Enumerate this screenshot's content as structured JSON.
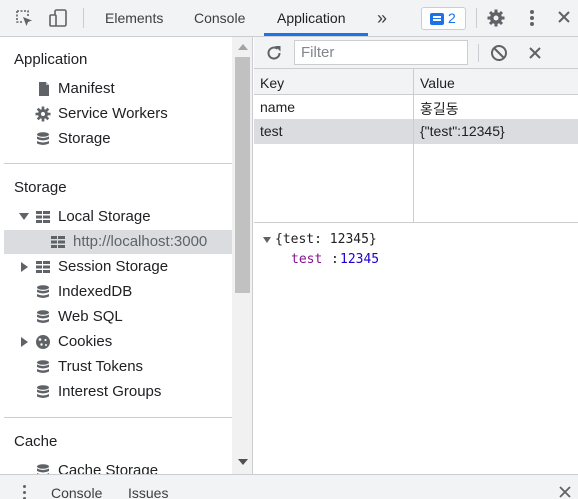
{
  "toolbar": {
    "tabs": [
      {
        "label": "Elements",
        "active": false
      },
      {
        "label": "Console",
        "active": false
      },
      {
        "label": "Application",
        "active": true
      }
    ],
    "more_tabs_label": "»",
    "messages_count": "2",
    "accent_color": "#1a73e8"
  },
  "sidebar": {
    "application": {
      "title": "Application",
      "items": [
        {
          "label": "Manifest",
          "icon": "file-icon"
        },
        {
          "label": "Service Workers",
          "icon": "gear-icon"
        },
        {
          "label": "Storage",
          "icon": "database-icon"
        }
      ]
    },
    "storage": {
      "title": "Storage",
      "items": [
        {
          "label": "Local Storage",
          "icon": "table-icon",
          "expanded": true
        },
        {
          "label": "http://localhost:3000",
          "icon": "table-icon",
          "selected": true
        },
        {
          "label": "Session Storage",
          "icon": "table-icon",
          "expanded": false
        },
        {
          "label": "IndexedDB",
          "icon": "database-icon"
        },
        {
          "label": "Web SQL",
          "icon": "database-icon"
        },
        {
          "label": "Cookies",
          "icon": "cookie-icon",
          "expanded": false
        },
        {
          "label": "Trust Tokens",
          "icon": "database-icon"
        },
        {
          "label": "Interest Groups",
          "icon": "database-icon"
        }
      ]
    },
    "cache": {
      "title": "Cache",
      "items": [
        {
          "label": "Cache Storage",
          "icon": "database-icon"
        }
      ]
    }
  },
  "main": {
    "filter": {
      "placeholder": "Filter",
      "value": ""
    },
    "table": {
      "columns": [
        "Key",
        "Value"
      ],
      "rows": [
        {
          "key": "name",
          "value": "홍길동",
          "selected": false
        },
        {
          "key": "test",
          "value": "{\"test\":12345}",
          "selected": true
        }
      ]
    },
    "preview": {
      "summary": "{test: 12345}",
      "prop_key": "test",
      "prop_value": "12345"
    }
  },
  "drawer": {
    "tabs": [
      "Console",
      "Issues"
    ]
  }
}
